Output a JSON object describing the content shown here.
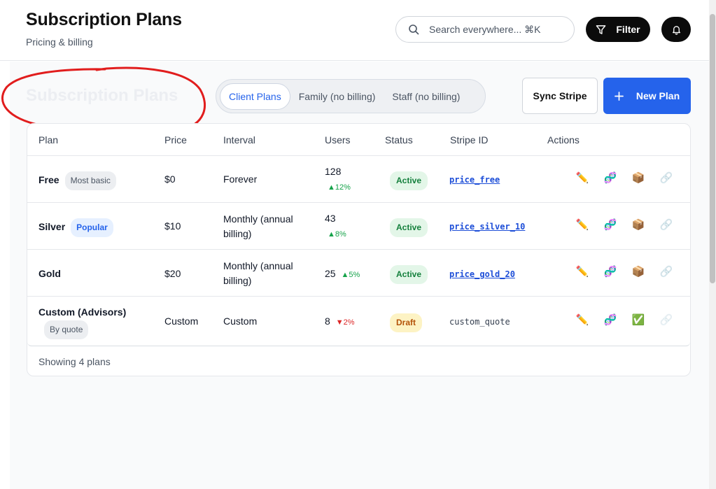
{
  "header": {
    "title": "Subscription Plans",
    "subtitle": "Pricing & billing",
    "search_placeholder": "Search everywhere... ⌘K",
    "filter_label": "Filter"
  },
  "page": {
    "ghost_title": "Subscription Plans",
    "tabs": [
      "Client Plans",
      "Family (no billing)",
      "Staff (no billing)"
    ],
    "active_tab": "Client Plans",
    "sync_label": "Sync Stripe",
    "new_plan_label": "New Plan"
  },
  "table": {
    "columns": [
      "Plan",
      "Price",
      "Interval",
      "Users",
      "Status",
      "Stripe ID",
      "Actions"
    ],
    "rows": [
      {
        "plan": "Free",
        "badge": "Most basic",
        "price": "$0",
        "interval": "Forever",
        "users": "128",
        "trend": "▲12%",
        "status": "Active",
        "stripe_id": "price_free"
      },
      {
        "plan": "Silver",
        "badge": "Popular",
        "price": "$10",
        "interval": "Monthly (annual billing)",
        "users": "43",
        "trend": "▲8%",
        "status": "Active",
        "stripe_id": "price_silver_10"
      },
      {
        "plan": "Gold",
        "badge": "",
        "price": "$20",
        "interval": "Monthly (annual billing)",
        "users": "25",
        "trend": "▲5%",
        "status": "Active",
        "stripe_id": "price_gold_20"
      },
      {
        "plan": "Custom (Advisors)",
        "badge": "By quote",
        "price": "Custom",
        "interval": "Custom",
        "users": "8",
        "trend": "▼2%",
        "status": "Draft",
        "stripe_id": "custom_quote"
      }
    ],
    "footer": "Showing 4 plans"
  },
  "icons": {
    "edit": "✏️",
    "dna": "🧬",
    "package": "📦",
    "check": "✅",
    "link": "🔗"
  },
  "colors": {
    "primary": "#2563eb",
    "annotation": "#e11d1d",
    "active_status": "#15803d",
    "draft_status": "#b45309"
  }
}
